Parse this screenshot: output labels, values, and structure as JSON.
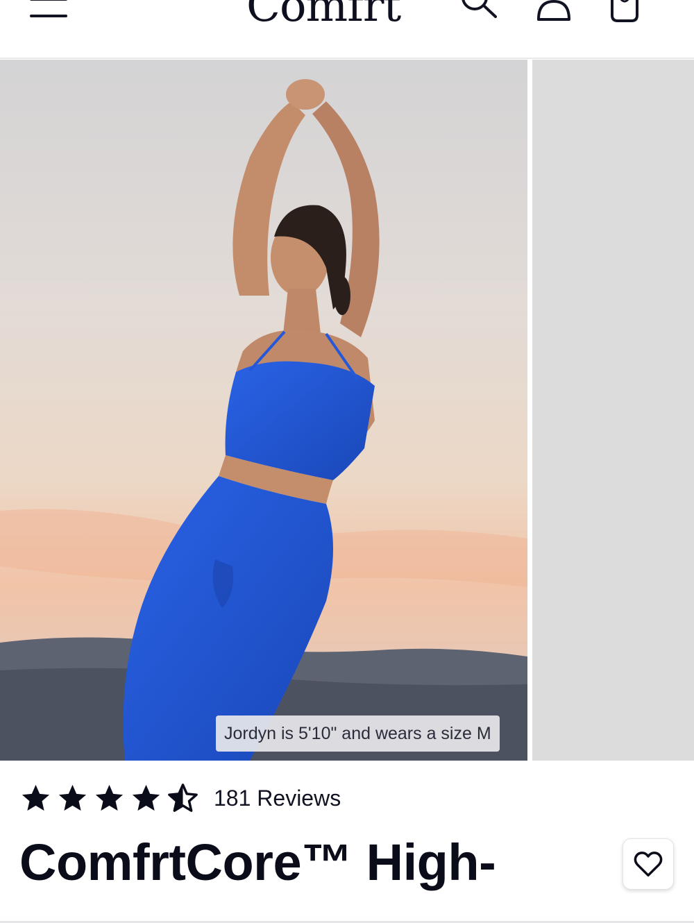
{
  "header": {
    "logo_text": "Comfrt",
    "menu_icon": "hamburger-menu-icon",
    "search_icon": "search-icon",
    "account_icon": "user-icon",
    "cart_icon": "shopping-bag-icon"
  },
  "gallery": {
    "model_caption": "Jordyn is 5'10\" and wears a size M",
    "product_color": "#1f55d6"
  },
  "rating": {
    "value": 4.5,
    "max": 5,
    "reviews_text": "181 Reviews"
  },
  "product": {
    "title": "ComfrtCore™ High-",
    "favorite_icon": "heart-icon"
  },
  "colors": {
    "text": "#0e0f1f",
    "placeholder_slide": "#dcdcdd"
  }
}
